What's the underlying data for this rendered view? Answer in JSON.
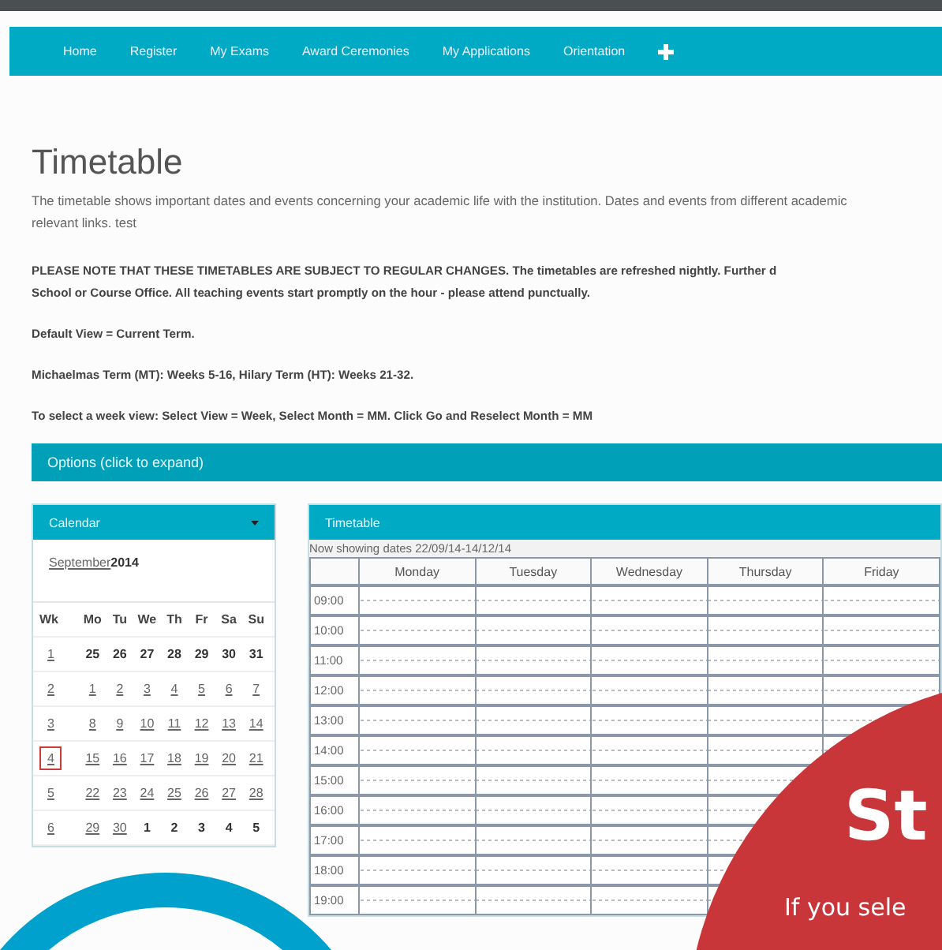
{
  "nav": {
    "items": [
      {
        "label": "Home"
      },
      {
        "label": "Register"
      },
      {
        "label": "My Exams"
      },
      {
        "label": "Award Ceremonies"
      },
      {
        "label": "My Applications"
      },
      {
        "label": "Orientation"
      }
    ]
  },
  "page": {
    "title": "Timetable",
    "intro": [
      "The timetable shows important dates and events concerning your academic life with the institution. Dates and events from different academic",
      "relevant links. test"
    ],
    "notes": [
      [
        "PLEASE NOTE THAT THESE TIMETABLES ARE SUBJECT TO REGULAR CHANGES. The timetables are refreshed nightly. Further d",
        "School or Course Office. All teaching events start promptly on the hour - please attend punctually."
      ],
      [
        "Default View = Current Term."
      ],
      [
        "Michaelmas Term (MT): Weeks 5-16, Hilary Term (HT): Weeks 21-32."
      ],
      [
        "To select a week view: Select View = Week, Select Month = MM. Click Go and Reselect Month = MM"
      ]
    ],
    "options_bar": "Options (click to expand)"
  },
  "calendar": {
    "title": "Calendar",
    "month": "September",
    "year": "2014",
    "headers": [
      "Wk",
      "Mo",
      "Tu",
      "We",
      "Th",
      "Fr",
      "Sa",
      "Su"
    ],
    "weeks": [
      {
        "week": "1",
        "selected": false,
        "days": [
          {
            "day": "25",
            "in_month": false
          },
          {
            "day": "26",
            "in_month": false
          },
          {
            "day": "27",
            "in_month": false
          },
          {
            "day": "28",
            "in_month": false
          },
          {
            "day": "29",
            "in_month": false
          },
          {
            "day": "30",
            "in_month": false
          },
          {
            "day": "31",
            "in_month": false
          }
        ]
      },
      {
        "week": "2",
        "selected": false,
        "days": [
          {
            "day": "1",
            "in_month": true
          },
          {
            "day": "2",
            "in_month": true
          },
          {
            "day": "3",
            "in_month": true
          },
          {
            "day": "4",
            "in_month": true
          },
          {
            "day": "5",
            "in_month": true
          },
          {
            "day": "6",
            "in_month": true
          },
          {
            "day": "7",
            "in_month": true
          }
        ]
      },
      {
        "week": "3",
        "selected": false,
        "days": [
          {
            "day": "8",
            "in_month": true
          },
          {
            "day": "9",
            "in_month": true
          },
          {
            "day": "10",
            "in_month": true
          },
          {
            "day": "11",
            "in_month": true
          },
          {
            "day": "12",
            "in_month": true
          },
          {
            "day": "13",
            "in_month": true
          },
          {
            "day": "14",
            "in_month": true
          }
        ]
      },
      {
        "week": "4",
        "selected": true,
        "days": [
          {
            "day": "15",
            "in_month": true
          },
          {
            "day": "16",
            "in_month": true
          },
          {
            "day": "17",
            "in_month": true
          },
          {
            "day": "18",
            "in_month": true
          },
          {
            "day": "19",
            "in_month": true
          },
          {
            "day": "20",
            "in_month": true
          },
          {
            "day": "21",
            "in_month": true
          }
        ]
      },
      {
        "week": "5",
        "selected": false,
        "days": [
          {
            "day": "22",
            "in_month": true
          },
          {
            "day": "23",
            "in_month": true
          },
          {
            "day": "24",
            "in_month": true
          },
          {
            "day": "25",
            "in_month": true
          },
          {
            "day": "26",
            "in_month": true
          },
          {
            "day": "27",
            "in_month": true
          },
          {
            "day": "28",
            "in_month": true
          }
        ]
      },
      {
        "week": "6",
        "selected": false,
        "days": [
          {
            "day": "29",
            "in_month": true
          },
          {
            "day": "30",
            "in_month": true
          },
          {
            "day": "1",
            "in_month": false
          },
          {
            "day": "2",
            "in_month": false
          },
          {
            "day": "3",
            "in_month": false
          },
          {
            "day": "4",
            "in_month": false
          },
          {
            "day": "5",
            "in_month": false
          }
        ]
      }
    ]
  },
  "timetable": {
    "title": "Timetable",
    "showing": "Now showing dates  22/09/14-14/12/14",
    "columns": [
      "Monday",
      "Tuesday",
      "Wednesday",
      "Thursday",
      "Friday"
    ],
    "times": [
      "09:00",
      "10:00",
      "11:00",
      "12:00",
      "13:00",
      "14:00",
      "15:00",
      "16:00",
      "17:00",
      "18:00",
      "19:00"
    ]
  },
  "overlay": {
    "heading": "St",
    "text": "If you sele"
  }
}
